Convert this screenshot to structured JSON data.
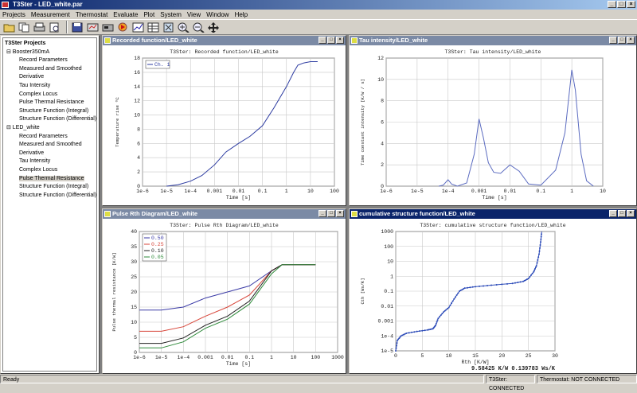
{
  "window": {
    "title": "T3Ster - LED_white.par",
    "min": "_",
    "max": "□",
    "close": "×"
  },
  "menu": [
    "Projects",
    "Measurement",
    "Thermostat",
    "Evaluate",
    "Plot",
    "System",
    "View",
    "Window",
    "Help"
  ],
  "toolbar_icons": [
    "open-folder-icon",
    "copy-icon",
    "print-icon",
    "print-preview-icon",
    "save-icon",
    "settings-icon",
    "measure-icon",
    "run-icon",
    "chart-icon",
    "table-icon",
    "fit-window-icon",
    "zoom-in-icon",
    "zoom-out-icon",
    "pan-icon"
  ],
  "tree": {
    "title": "T3Ster Projects",
    "items": [
      {
        "label": "Booster350mA",
        "level": 0
      },
      {
        "label": "Record Parameters",
        "level": 1
      },
      {
        "label": "Measured and Smoothed",
        "level": 1
      },
      {
        "label": "Derivative",
        "level": 1
      },
      {
        "label": "Tau Intensity",
        "level": 1
      },
      {
        "label": "Complex Locus",
        "level": 1
      },
      {
        "label": "Pulse Thermal Resistance",
        "level": 1
      },
      {
        "label": "Structure Function (Integral)",
        "level": 1
      },
      {
        "label": "Structure Function (Differential)",
        "level": 1
      },
      {
        "label": "LED_white",
        "level": 0
      },
      {
        "label": "Record Parameters",
        "level": 1
      },
      {
        "label": "Measured and Smoothed",
        "level": 1
      },
      {
        "label": "Derivative",
        "level": 1
      },
      {
        "label": "Tau Intensity",
        "level": 1
      },
      {
        "label": "Complex Locus",
        "level": 1
      },
      {
        "label": "Pulse Thermal Resistance",
        "level": 1,
        "selected": true
      },
      {
        "label": "Structure Function (Integral)",
        "level": 1
      },
      {
        "label": "Structure Function (Differential)",
        "level": 1
      }
    ]
  },
  "panels": {
    "recorded": {
      "title": "Recorded function/LED_white"
    },
    "tau": {
      "title": "Tau intensity/LED_white"
    },
    "pulse": {
      "title": "Pulse Rth Diagram/LED_white"
    },
    "cumulative": {
      "title": "cumulative structure function/LED_white"
    }
  },
  "status": {
    "left": "Ready",
    "t3ster": "T3Ster: CONNECTED",
    "thermostat": "Thermostat: NOT CONNECTED"
  },
  "chart_data": [
    {
      "type": "line",
      "title": "T3Ster: Recorded function/LED_white",
      "xlabel": "Time  [s]",
      "ylabel": "Temperature rise  ºC",
      "xscale": "log",
      "xticks": [
        "1e-6",
        "1e-5",
        "1e-4",
        "0.001",
        "0.01",
        "0.1",
        "1",
        "10",
        "100"
      ],
      "yticks": [
        "0",
        "2",
        "4",
        "6",
        "8",
        "10",
        "12",
        "14",
        "16",
        "18"
      ],
      "ylim": [
        0,
        18
      ],
      "legend": [
        "Ch. 1"
      ],
      "color": "#2b3aa0",
      "series": [
        {
          "name": "Ch. 1",
          "x": [
            1e-05,
            3e-05,
            0.0001,
            0.0003,
            0.001,
            0.003,
            0.01,
            0.03,
            0.1,
            0.3,
            1,
            2,
            3,
            5,
            10,
            20
          ],
          "y": [
            0,
            0.2,
            0.7,
            1.5,
            3,
            4.8,
            6,
            7,
            8.5,
            11,
            14,
            16,
            17,
            17.3,
            17.5,
            17.5
          ]
        }
      ]
    },
    {
      "type": "line",
      "title": "T3Ster: Tau intensity/LED_white",
      "xlabel": "Time  [s]",
      "ylabel": "Time constant intensity  [K/W / s]",
      "xscale": "log",
      "xticks": [
        "1e-6",
        "1e-5",
        "1e-4",
        "0.001",
        "0.01",
        "0.1",
        "1",
        "10"
      ],
      "yticks": [
        "0",
        "2",
        "4",
        "6",
        "8",
        "10",
        "12"
      ],
      "ylim": [
        0,
        12
      ],
      "color": "#5b6bc0",
      "series": [
        {
          "x": [
            5e-05,
            7e-05,
            0.0001,
            0.00013,
            0.0002,
            0.0004,
            0.0007,
            0.001,
            0.0014,
            0.002,
            0.003,
            0.005,
            0.01,
            0.02,
            0.04,
            0.1,
            0.3,
            0.6,
            1,
            1.3,
            2,
            3,
            5
          ],
          "y": [
            0,
            0.1,
            0.6,
            0.2,
            0,
            0.3,
            3,
            6.3,
            4.5,
            2.2,
            1.3,
            1.2,
            2,
            1.4,
            0.2,
            0.1,
            1.5,
            5,
            10.9,
            9,
            3,
            0.5,
            0
          ]
        }
      ]
    },
    {
      "type": "line",
      "title": "T3Ster: Pulse Rth Diagram/LED_white",
      "xlabel": "Time  [s]",
      "ylabel": "Pulse thermal resistance  [K/W]",
      "xscale": "log",
      "xticks": [
        "1e-6",
        "1e-5",
        "1e-4",
        "0.001",
        "0.01",
        "0.1",
        "1",
        "10",
        "100",
        "1000"
      ],
      "yticks": [
        "0",
        "5",
        "10",
        "15",
        "20",
        "25",
        "30",
        "35",
        "40"
      ],
      "ylim": [
        0,
        40
      ],
      "legend": [
        "0.50",
        "0.25",
        "0.10",
        "0.05"
      ],
      "series": [
        {
          "name": "0.50",
          "color": "#3a3aa6",
          "x": [
            1e-06,
            1e-05,
            0.0001,
            0.001,
            0.01,
            0.1,
            1,
            3,
            10,
            100
          ],
          "y": [
            14,
            14,
            15,
            18,
            20,
            22,
            27,
            29,
            29,
            29
          ]
        },
        {
          "name": "0.25",
          "color": "#d8463a",
          "x": [
            1e-06,
            1e-05,
            0.0001,
            0.001,
            0.01,
            0.1,
            1,
            3,
            10,
            100
          ],
          "y": [
            7,
            7,
            8.5,
            12,
            15,
            19,
            27,
            29,
            29,
            29
          ]
        },
        {
          "name": "0.10",
          "color": "#222222",
          "x": [
            1e-06,
            1e-05,
            0.0001,
            0.001,
            0.01,
            0.1,
            1,
            3,
            10,
            100
          ],
          "y": [
            3,
            3,
            4.8,
            9,
            12,
            17,
            27,
            29,
            29,
            29
          ]
        },
        {
          "name": "0.05",
          "color": "#2e8a3a",
          "x": [
            1e-06,
            1e-05,
            0.0001,
            0.001,
            0.01,
            0.1,
            1,
            3,
            10,
            100
          ],
          "y": [
            1.5,
            1.5,
            3.5,
            8,
            11,
            16,
            26,
            29,
            29,
            29
          ]
        }
      ]
    },
    {
      "type": "scatter",
      "title": "T3Ster: cumulative structure function/LED_white",
      "xlabel": "Rth  [K/W]",
      "ylabel": "Cth  [Ws/K]",
      "yscale": "log",
      "xticks": [
        "0",
        "5",
        "10",
        "15",
        "20",
        "25",
        "30"
      ],
      "yticks": [
        "1e-5",
        "1e-4",
        "0.001",
        "0.01",
        "0.1",
        "1",
        "10",
        "100",
        "1000"
      ],
      "xlim": [
        0,
        30
      ],
      "color": "#2b4ab8",
      "readout": "9.58425 K/W   0.139783 Ws/K",
      "series": [
        {
          "x": [
            0,
            0.3,
            1,
            2,
            4,
            6,
            7,
            7.5,
            8,
            9,
            10,
            11,
            12,
            13,
            15,
            18,
            22,
            24,
            25,
            26,
            26.5,
            27,
            27.3,
            27.5
          ],
          "y": [
            1e-05,
            5e-05,
            0.0001,
            0.00015,
            0.0002,
            0.00025,
            0.0003,
            0.0005,
            0.0015,
            0.004,
            0.008,
            0.03,
            0.1,
            0.16,
            0.2,
            0.25,
            0.33,
            0.45,
            0.7,
            2,
            5,
            30,
            200,
            1000
          ]
        }
      ]
    }
  ]
}
